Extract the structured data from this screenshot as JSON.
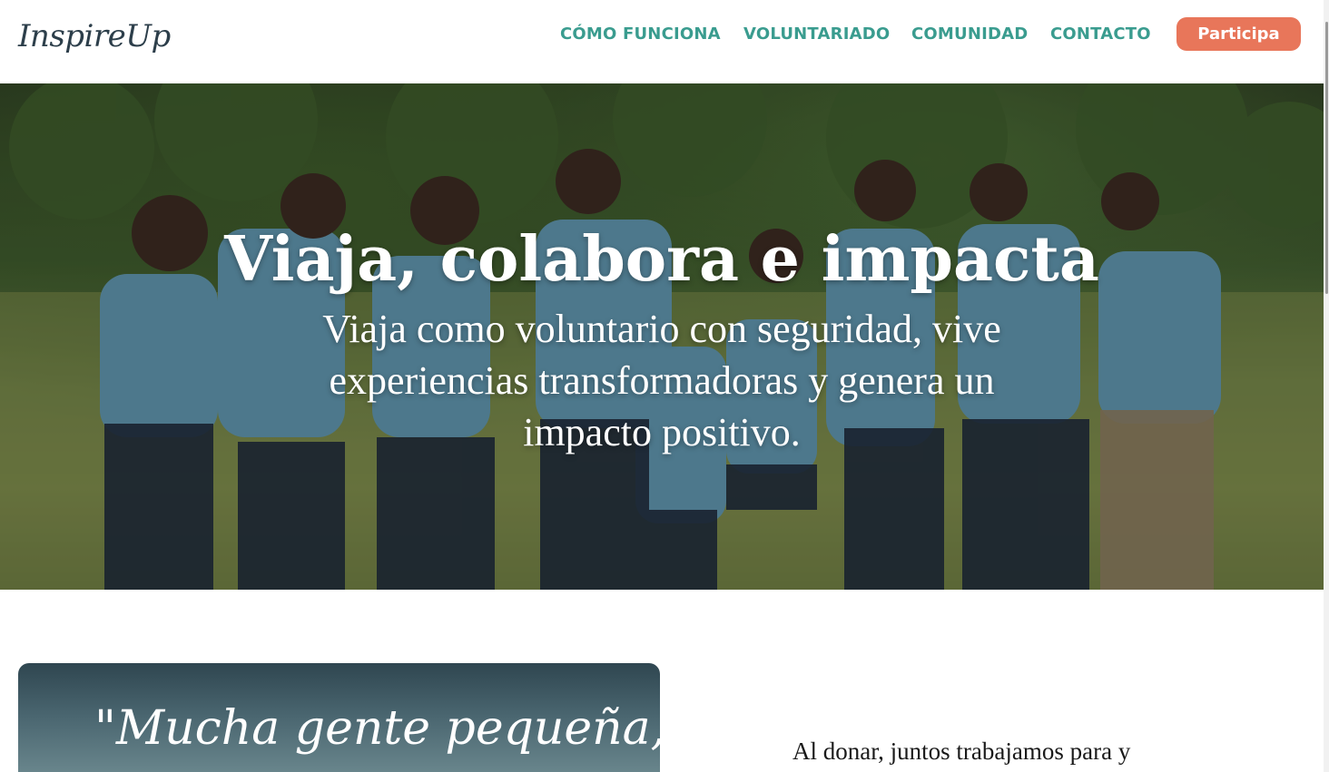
{
  "header": {
    "logo": "InspireUp",
    "nav": [
      "CÓMO FUNCIONA",
      "VOLUNTARIADO",
      "COMUNIDAD",
      "CONTACTO"
    ],
    "cta": "Participa"
  },
  "hero": {
    "title": "Viaja, colabora e impacta",
    "subtitle": "Viaja como voluntario con seguridad, vive experiencias transformadoras y genera un impacto positivo."
  },
  "quote": {
    "text": "\"Mucha gente pequeña, en"
  },
  "donate": {
    "text": "Al donar, juntos trabajamos para y"
  },
  "colors": {
    "nav": "#3a9c8f",
    "cta": "#e8765a",
    "logo": "#2c3e4a"
  }
}
